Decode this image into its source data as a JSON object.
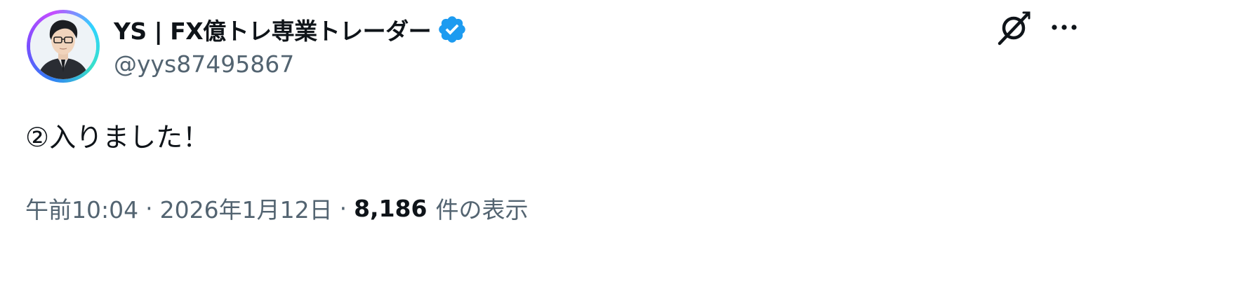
{
  "author": {
    "display_name": "YS | FX億トレ専業トレーダー",
    "handle": "@yys87495867",
    "verified": true
  },
  "tweet": {
    "text": "②入りました！"
  },
  "meta": {
    "time": "午前10:04",
    "separator": "·",
    "date": "2026年1月12日",
    "views_count": "8,186",
    "views_label": "件の表示"
  },
  "icons": {
    "verified": "verified-badge-icon",
    "grok": "grok-icon",
    "more": "more-icon"
  },
  "colors": {
    "text_primary": "#0f1419",
    "text_secondary": "#536471",
    "verified_blue": "#1d9bf0",
    "background": "#ffffff"
  }
}
